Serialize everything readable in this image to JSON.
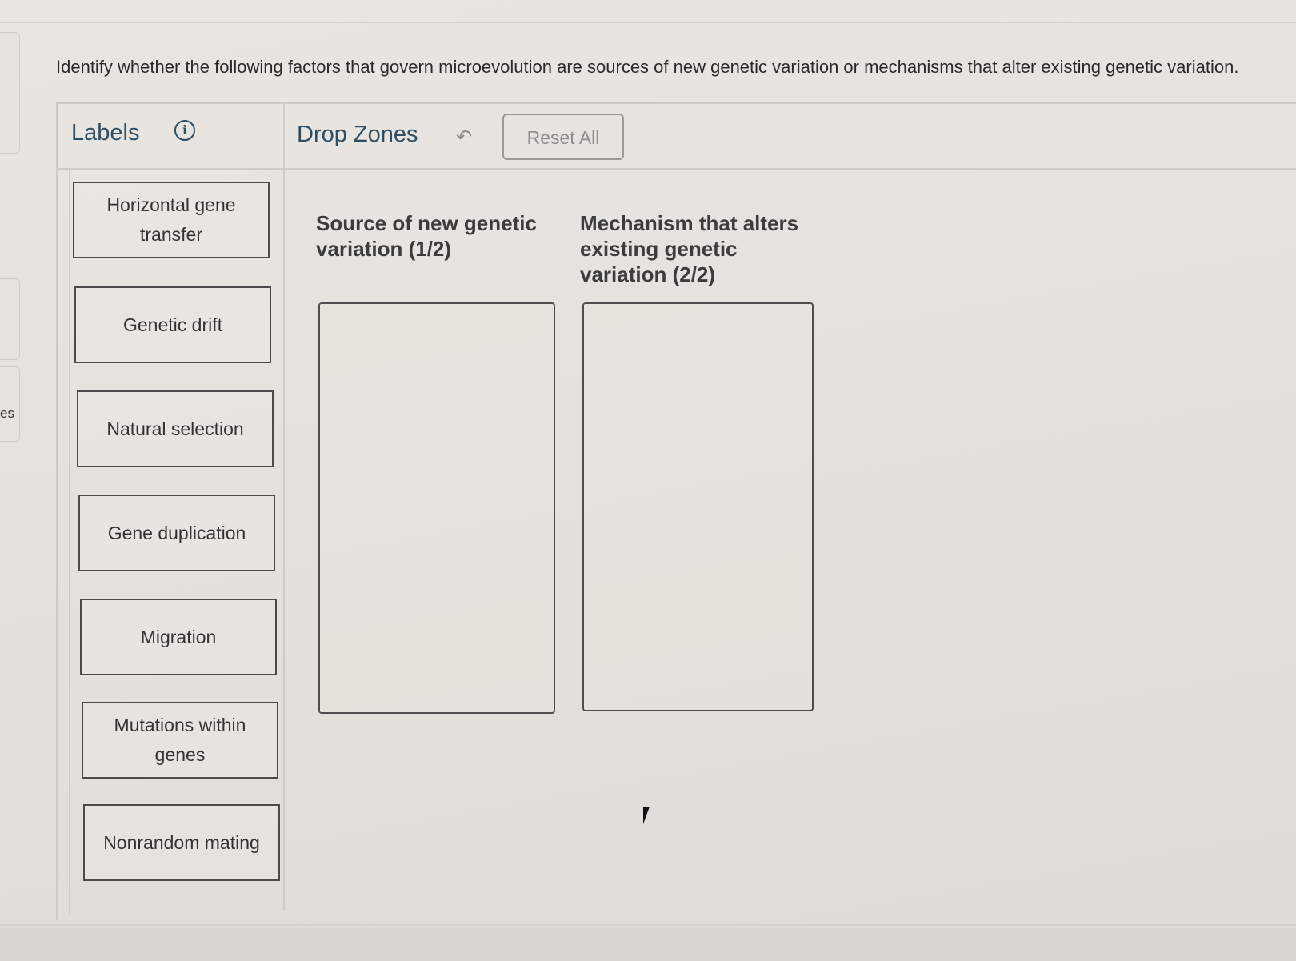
{
  "question": {
    "prompt": "Identify whether the following factors that govern microevolution are sources of new genetic variation or mechanisms that alter existing genetic variation."
  },
  "side_rail": {
    "visible_text": "es"
  },
  "labels_panel": {
    "title": "Labels",
    "info_icon": "info-icon",
    "items": [
      {
        "label": "Horizontal gene transfer"
      },
      {
        "label": "Genetic drift"
      },
      {
        "label": "Natural selection"
      },
      {
        "label": "Gene duplication"
      },
      {
        "label": "Migration"
      },
      {
        "label": "Mutations within genes"
      },
      {
        "label": "Nonrandom mating"
      }
    ]
  },
  "drop_zones_panel": {
    "title": "Drop Zones",
    "undo_icon": "undo-arrow-icon",
    "reset_label": "Reset All",
    "zones": [
      {
        "title": "Source of new genetic variation (1/2)"
      },
      {
        "title": "Mechanism that alters existing genetic variation (2/2)"
      }
    ]
  }
}
